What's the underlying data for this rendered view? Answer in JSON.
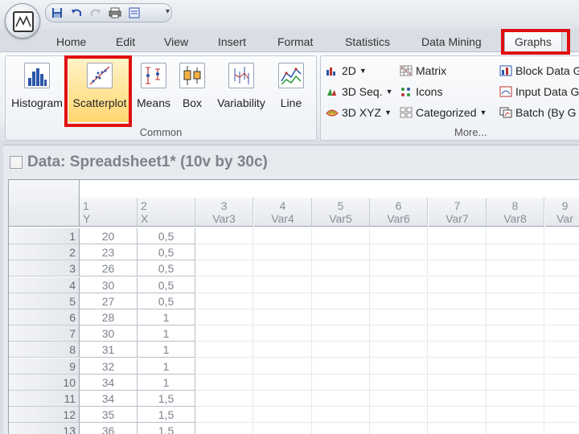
{
  "toolbar": {
    "quick_access_icons": [
      "save-icon",
      "undo-icon",
      "redo-icon",
      "print-icon",
      "properties-icon"
    ],
    "customize_glyph": "▾"
  },
  "tabs": [
    {
      "name": "home",
      "label": "Home"
    },
    {
      "name": "edit",
      "label": "Edit"
    },
    {
      "name": "view",
      "label": "View"
    },
    {
      "name": "insert",
      "label": "Insert"
    },
    {
      "name": "format",
      "label": "Format"
    },
    {
      "name": "statistics",
      "label": "Statistics"
    },
    {
      "name": "data-mining",
      "label": "Data Mining"
    },
    {
      "name": "graphs",
      "label": "Graphs",
      "selected": true
    }
  ],
  "ribbon": {
    "common": {
      "label": "Common",
      "buttons": [
        "Histogram",
        "Scatterplot",
        "Means",
        "Box",
        "Variability",
        "Line"
      ]
    },
    "more": {
      "label": "More...",
      "col1": [
        "2D",
        "3D Seq.",
        "3D XYZ"
      ],
      "col2": [
        "Matrix",
        "Icons",
        "Categorized"
      ],
      "col3": [
        "Block Data G",
        "Input Data G",
        "Batch (By G"
      ]
    }
  },
  "spreadsheet": {
    "title": "Data: Spreadsheet1* (10v by 30c)",
    "columns": [
      {
        "num": "1",
        "name": "Y"
      },
      {
        "num": "2",
        "name": "X"
      },
      {
        "num": "3",
        "name": "Var3"
      },
      {
        "num": "4",
        "name": "Var4"
      },
      {
        "num": "5",
        "name": "Var5"
      },
      {
        "num": "6",
        "name": "Var6"
      },
      {
        "num": "7",
        "name": "Var7"
      },
      {
        "num": "8",
        "name": "Var8"
      },
      {
        "num": "9",
        "name": "Var"
      }
    ],
    "rows": [
      {
        "n": "1",
        "y": "20",
        "x": "0,5"
      },
      {
        "n": "2",
        "y": "23",
        "x": "0,5"
      },
      {
        "n": "3",
        "y": "26",
        "x": "0,5"
      },
      {
        "n": "4",
        "y": "30",
        "x": "0,5"
      },
      {
        "n": "5",
        "y": "27",
        "x": "0,5"
      },
      {
        "n": "6",
        "y": "28",
        "x": "1"
      },
      {
        "n": "7",
        "y": "30",
        "x": "1"
      },
      {
        "n": "8",
        "y": "31",
        "x": "1"
      },
      {
        "n": "9",
        "y": "32",
        "x": "1"
      },
      {
        "n": "10",
        "y": "34",
        "x": "1"
      },
      {
        "n": "11",
        "y": "34",
        "x": "1,5"
      },
      {
        "n": "12",
        "y": "35",
        "x": "1,5"
      },
      {
        "n": "13",
        "y": "36",
        "x": "1,5"
      }
    ]
  },
  "colors": {
    "highlight": "#e01010",
    "scatter_active": "#ffd770"
  }
}
